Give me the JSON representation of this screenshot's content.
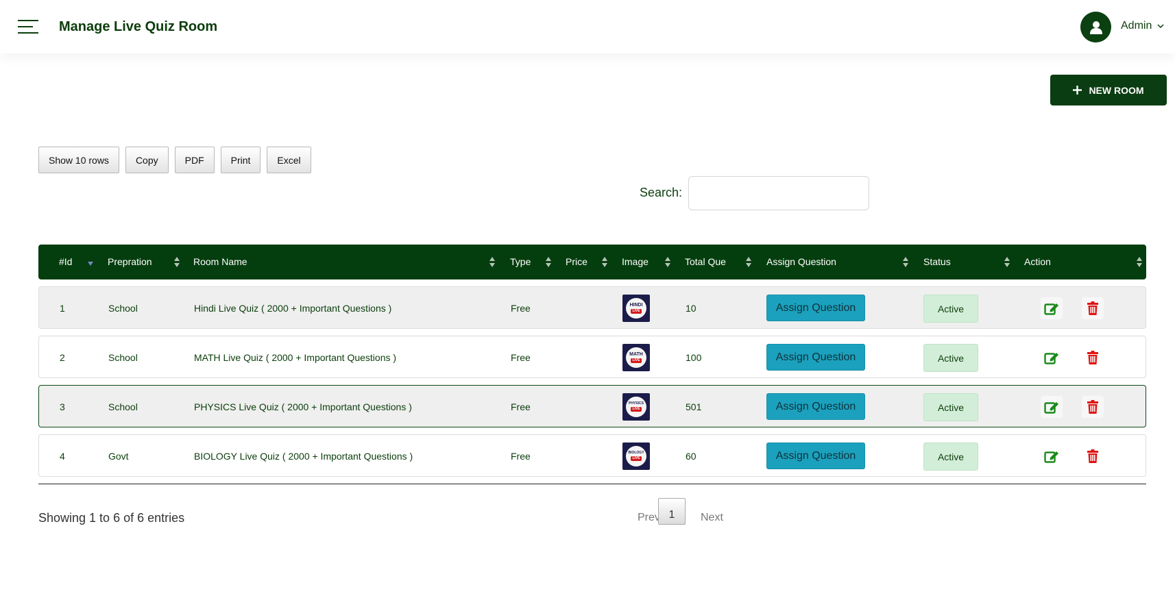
{
  "header": {
    "title": "Manage Live Quiz Room",
    "user_label": "Admin"
  },
  "actions": {
    "new_room_label": "NEW ROOM"
  },
  "toolbar": {
    "buttons": [
      "Show 10 rows",
      "Copy",
      "PDF",
      "Print",
      "Excel"
    ]
  },
  "search": {
    "label": "Search:",
    "value": ""
  },
  "table": {
    "columns": [
      "#Id",
      "Prepration",
      "Room Name",
      "Type",
      "Price",
      "Image",
      "Total Que",
      "Assign Question",
      "Status",
      "Action"
    ],
    "rows": [
      {
        "id": "1",
        "prepration": "School",
        "room_name": "Hindi Live Quiz ( 2000 + Important Questions )",
        "type": "Free",
        "price": "",
        "image_text": "HINDI",
        "image_badge": "LIVE",
        "total_que": "10",
        "assign_label": "Assign Question",
        "status": "Active"
      },
      {
        "id": "2",
        "prepration": "School",
        "room_name": "MATH Live Quiz ( 2000 + Important Questions )",
        "type": "Free",
        "price": "",
        "image_text": "MATH",
        "image_badge": "LIVE",
        "total_que": "100",
        "assign_label": "Assign Question",
        "status": "Active"
      },
      {
        "id": "3",
        "prepration": "School",
        "room_name": "PHYSICS Live Quiz ( 2000 + Important Questions )",
        "type": "Free",
        "price": "",
        "image_text": "PHYSICS",
        "image_badge": "LIVE",
        "total_que": "501",
        "assign_label": "Assign Question",
        "status": "Active"
      },
      {
        "id": "4",
        "prepration": "Govt",
        "room_name": "BIOLOGY Live Quiz ( 2000 + Important Questions )",
        "type": "Free",
        "price": "",
        "image_text": "BIOLOGY",
        "image_badge": "LIVE",
        "total_que": "60",
        "assign_label": "Assign Question",
        "status": "Active"
      }
    ]
  },
  "footer": {
    "info": "Showing 1 to 6 of 6 entries",
    "prev_label": "Prev",
    "current_page": "1",
    "next_label": "Next"
  },
  "colors": {
    "brand_dark_green": "#053e0e",
    "assign_button": "#1ba1bd",
    "status_active_bg": "#d3eed8",
    "edit_icon": "#1a8a1a",
    "delete_icon": "#e01414"
  },
  "icons": [
    "hamburger-icon",
    "user-icon",
    "chevron-down-icon",
    "plus-icon",
    "sort-icon",
    "edit-icon",
    "trash-icon"
  ]
}
